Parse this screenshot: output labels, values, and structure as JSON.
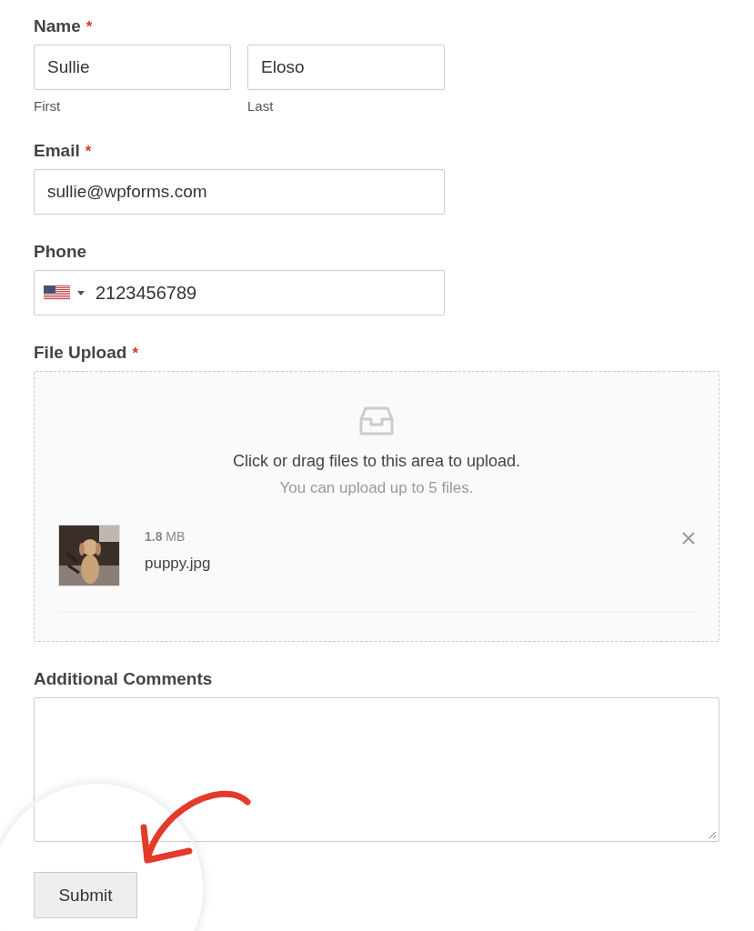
{
  "fields": [
    {
      "kind": "name",
      "label": "Name",
      "required_mark": "*",
      "parts": [
        {
          "value": "Sullie",
          "sublabel": "First"
        },
        {
          "value": "Eloso",
          "sublabel": "Last"
        }
      ]
    },
    {
      "kind": "text",
      "label": "Email",
      "required_mark": "*",
      "value": "sullie@wpforms.com"
    },
    {
      "kind": "phone",
      "label": "Phone",
      "value": "2123456789"
    },
    {
      "kind": "upload",
      "label": "File Upload",
      "required_mark": "*",
      "prompt": "Click or drag files to this area to upload.",
      "hint": "You can upload up to 5 files.",
      "files": [
        {
          "size": "**1.8** MB",
          "name": "puppy.jpg"
        }
      ]
    },
    {
      "kind": "textarea",
      "label": "Additional Comments"
    }
  ],
  "submit": "Submit"
}
